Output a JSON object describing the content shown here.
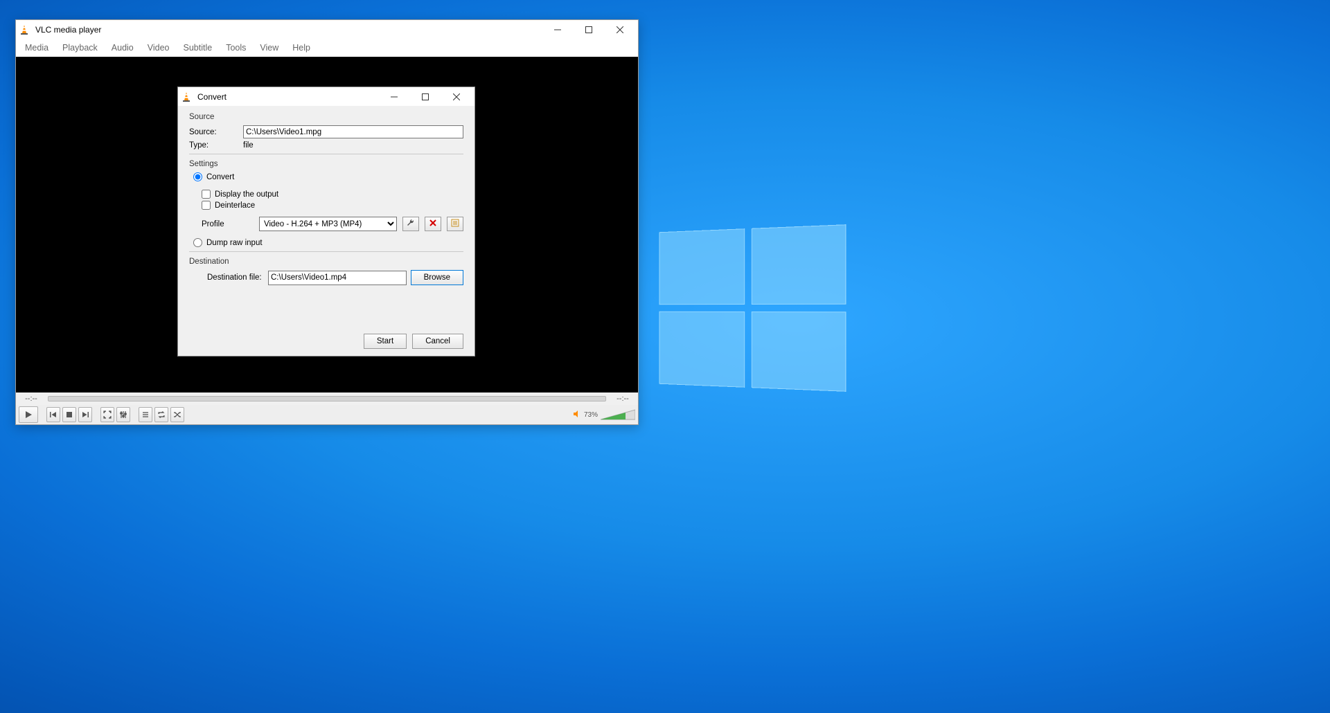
{
  "vlc": {
    "title": "VLC media player",
    "menus": [
      "Media",
      "Playback",
      "Audio",
      "Video",
      "Subtitle",
      "Tools",
      "View",
      "Help"
    ],
    "time_left": "--:--",
    "time_right": "--:--",
    "volume_label": "73%"
  },
  "convert": {
    "title": "Convert",
    "source_section": "Source",
    "source_label": "Source:",
    "source_value": "C:\\Users\\Video1.mpg",
    "type_label": "Type:",
    "type_value": "file",
    "settings_section": "Settings",
    "convert_radio": "Convert",
    "display_output": "Display the output",
    "deinterlace": "Deinterlace",
    "profile_label": "Profile",
    "profile_value": "Video - H.264 + MP3 (MP4)",
    "dump_radio": "Dump raw input",
    "destination_section": "Destination",
    "dest_file_label": "Destination file:",
    "dest_file_value": "C:\\Users\\Video1.mp4",
    "browse": "Browse",
    "start": "Start",
    "cancel": "Cancel"
  }
}
